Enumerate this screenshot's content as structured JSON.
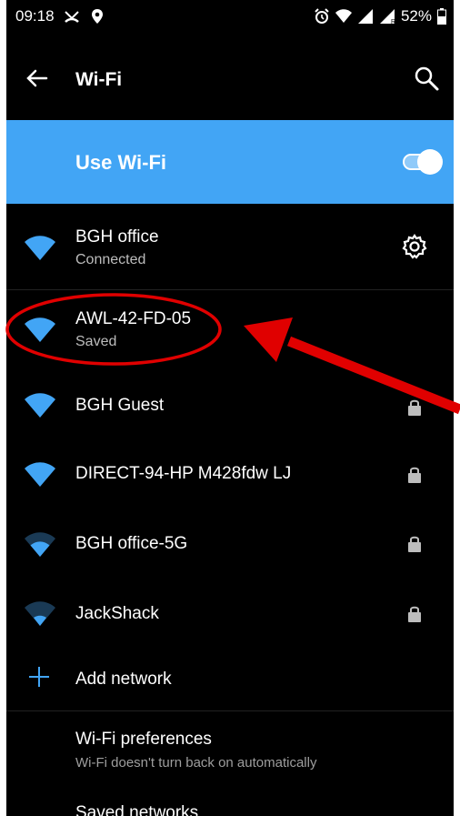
{
  "status_bar": {
    "time": "09:18",
    "battery": "52%"
  },
  "toolbar": {
    "title": "Wi-Fi"
  },
  "use_wifi": {
    "label": "Use Wi-Fi",
    "enabled": true
  },
  "networks": [
    {
      "name": "BGH office",
      "status": "Connected",
      "signal": "full",
      "secured": false,
      "has_settings": true
    },
    {
      "name": "AWL-42-FD-05",
      "status": "Saved",
      "signal": "full",
      "secured": false,
      "has_settings": false
    },
    {
      "name": "BGH Guest",
      "status": "",
      "signal": "full",
      "secured": true,
      "has_settings": false
    },
    {
      "name": "DIRECT-94-HP M428fdw LJ",
      "status": "",
      "signal": "full",
      "secured": true,
      "has_settings": false
    },
    {
      "name": "BGH office-5G",
      "status": "",
      "signal": "medium",
      "secured": true,
      "has_settings": false
    },
    {
      "name": "JackShack",
      "status": "",
      "signal": "low",
      "secured": true,
      "has_settings": false
    }
  ],
  "add_network": {
    "label": "Add network"
  },
  "preferences": {
    "title": "Wi-Fi preferences",
    "subtitle": "Wi-Fi doesn't turn back on automatically"
  },
  "cut_off_text": "Saved networks",
  "colors": {
    "accent": "#42a5f5",
    "background": "#000000",
    "annotation": "#e00000"
  }
}
